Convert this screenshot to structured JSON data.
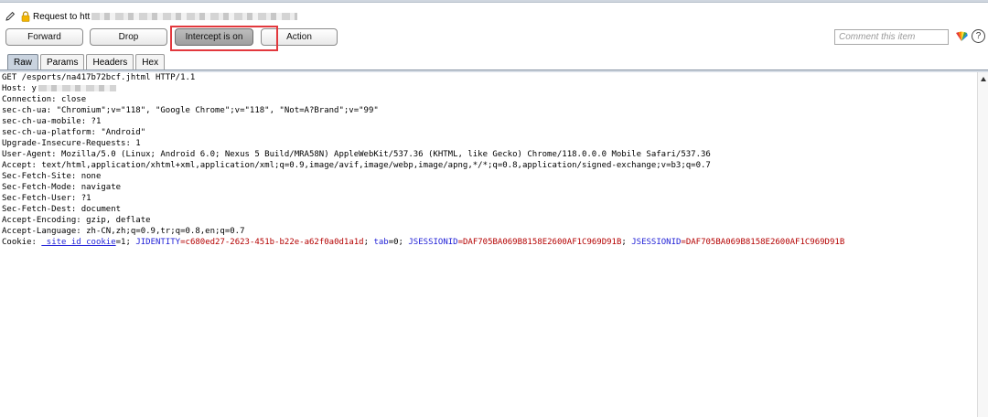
{
  "header": {
    "request_prefix": "Request to htt"
  },
  "toolbar": {
    "forward_label": "Forward",
    "drop_label": "Drop",
    "intercept_label": "Intercept is on",
    "action_label": "Action",
    "comment_placeholder": "Comment this item",
    "help_label": "?"
  },
  "tabs": [
    {
      "label": "Raw",
      "active": true
    },
    {
      "label": "Params",
      "active": false
    },
    {
      "label": "Headers",
      "active": false
    },
    {
      "label": "Hex",
      "active": false
    }
  ],
  "request": {
    "lines": [
      "GET /esports/na417b72bcf.jhtml HTTP/1.1",
      "Host: y",
      "Connection: close",
      "sec-ch-ua: \"Chromium\";v=\"118\", \"Google Chrome\";v=\"118\", \"Not=A?Brand\";v=\"99\"",
      "sec-ch-ua-mobile: ?1",
      "sec-ch-ua-platform: \"Android\"",
      "Upgrade-Insecure-Requests: 1",
      "User-Agent: Mozilla/5.0 (Linux; Android 6.0; Nexus 5 Build/MRA58N) AppleWebKit/537.36 (KHTML, like Gecko) Chrome/118.0.0.0 Mobile Safari/537.36",
      "Accept: text/html,application/xhtml+xml,application/xml;q=0.9,image/avif,image/webp,image/apng,*/*;q=0.8,application/signed-exchange;v=b3;q=0.7",
      "Sec-Fetch-Site: none",
      "Sec-Fetch-Mode: navigate",
      "Sec-Fetch-User: ?1",
      "Sec-Fetch-Dest: document",
      "Accept-Encoding: gzip, deflate",
      "Accept-Language: zh-CN,zh;q=0.9,tr;q=0.8,en;q=0.7"
    ],
    "cookie": {
      "prefix": "Cookie: ",
      "name1": "_site_id_cookie",
      "eq1": "=1; ",
      "name2": "JIDENTITY",
      "val2": "=c680ed27-2623-451b-b22e-a62f0a0d1a1d",
      "sep2": "; ",
      "name3": "tab",
      "eq3": "=0; ",
      "name4": "JSESSIONID",
      "val4": "=DAF705BA069B8158E2600AF1C969D91B",
      "sep4": "; ",
      "name5": "JSESSIONID",
      "val5": "=DAF705BA069B8158E2600AF1C969D91B"
    }
  },
  "colors": {
    "highlight": "#e2383d",
    "cookie_name": "#1f1fd6",
    "cookie_value": "#b40000"
  }
}
